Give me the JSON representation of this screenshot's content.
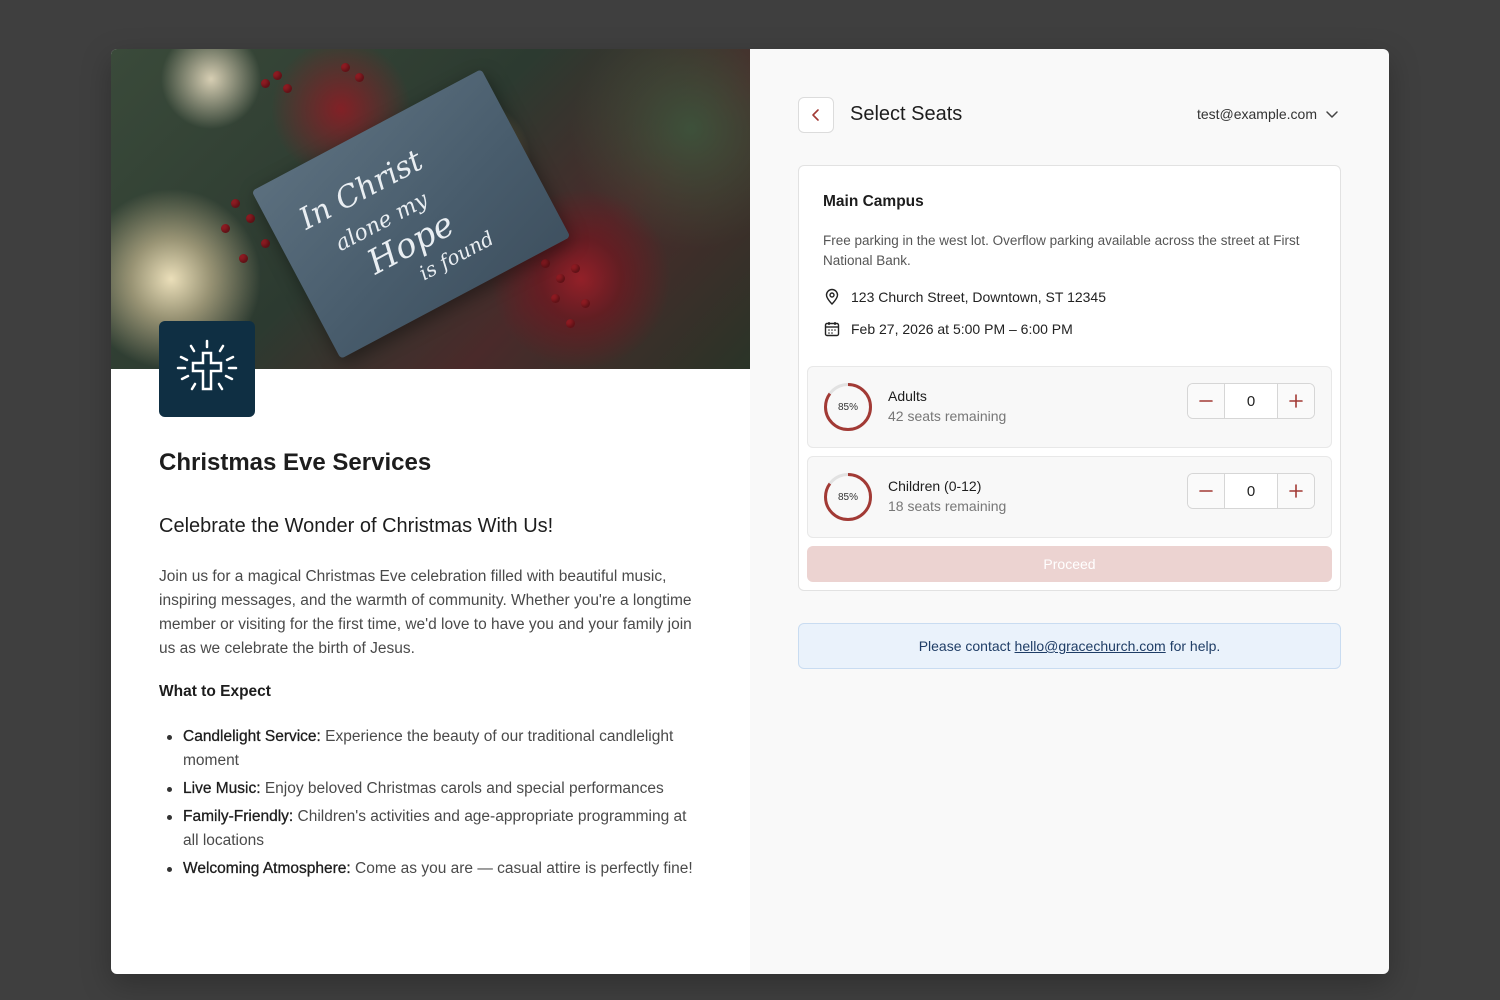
{
  "event": {
    "title": "Christmas Eve Services",
    "subtitle": "Celebrate the Wonder of Christmas With Us!",
    "description": "Join us for a magical Christmas Eve celebration filled with beautiful music, inspiring messages, and the warmth of community. Whether you're a longtime member or visiting for the first time, we'd love to have you and your family join us as we celebrate the birth of Jesus.",
    "expect_heading": "What to Expect",
    "expect_items": [
      {
        "label": "Candlelight Service:",
        "text": " Experience the beauty of our traditional candlelight moment"
      },
      {
        "label": "Live Music:",
        "text": " Enjoy beloved Christmas carols and special performances"
      },
      {
        "label": "Family-Friendly:",
        "text": " Children's activities and age-appropriate programming at all locations"
      },
      {
        "label": "Welcoming Atmosphere:",
        "text": " Come as you are — casual attire is perfectly fine!"
      }
    ],
    "logo_icon": "cross-icon",
    "hero_card_text": [
      "In Christ",
      "alone my",
      "Hope",
      "is found"
    ]
  },
  "header": {
    "title": "Select Seats",
    "user_email": "test@example.com",
    "back_icon": "chevron-left-icon"
  },
  "location": {
    "name": "Main Campus",
    "parking": "Free parking in the west lot. Overflow parking available across the street at First National Bank.",
    "address": "123 Church Street, Downtown, ST 12345",
    "datetime": "Feb 27, 2026 at 5:00 PM – 6:00 PM"
  },
  "tickets": [
    {
      "name": "Adults",
      "remaining": "42 seats remaining",
      "percent_label": "85%",
      "percent": 0.85,
      "quantity": "0"
    },
    {
      "name": "Children (0-12)",
      "remaining": "18 seats remaining",
      "percent_label": "85%",
      "percent": 0.85,
      "quantity": "0"
    }
  ],
  "proceed_label": "Proceed",
  "help": {
    "prefix": "Please contact",
    "email": "hello@gracechurch.com",
    "suffix": "for help."
  },
  "colors": {
    "accent": "#a23a35",
    "logo_bg": "#0f2f43",
    "proceed_disabled": "#ecd3d1",
    "help_bg": "#eaf2fb"
  }
}
